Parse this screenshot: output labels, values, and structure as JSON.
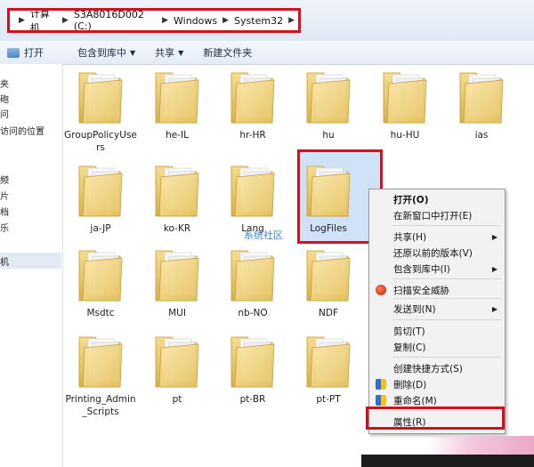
{
  "breadcrumb": {
    "segments": [
      "计算机",
      "S3A8016D002 (C:)",
      "Windows",
      "System32"
    ]
  },
  "toolbar": {
    "open": "打开",
    "include_library": "包含到库中",
    "share": "共享",
    "new_folder": "新建文件夹"
  },
  "nav": {
    "items": [
      "夹",
      "砲",
      "问",
      "访问的位置",
      "频",
      "片",
      "档",
      "乐",
      "机"
    ]
  },
  "folders": [
    "GroupPolicyUsers",
    "he-IL",
    "hr-HR",
    "hu",
    "hu-HU",
    "ias",
    "ja-JP",
    "ko-KR",
    "Lang",
    "LogFiles",
    "Msdtc",
    "MUI",
    "nb-NO",
    "NDF",
    "Printing_Admin_Scripts",
    "pt",
    "pt-BR",
    "pt-PT"
  ],
  "watermark": "系统社区",
  "context_menu": {
    "items": [
      {
        "label": "打开(O)",
        "bold": true
      },
      {
        "label": "在新窗口中打开(E)"
      },
      {
        "label": "共享(H)",
        "submenu": true
      },
      {
        "label": "还原以前的版本(V)"
      },
      {
        "label": "包含到库中(I)",
        "submenu": true
      },
      {
        "label": "扫描安全威胁"
      },
      {
        "label": "发送到(N)",
        "submenu": true
      },
      {
        "label": "剪切(T)"
      },
      {
        "label": "复制(C)"
      },
      {
        "label": "创建快捷方式(S)"
      },
      {
        "label": "删除(D)"
      },
      {
        "label": "重命名(M)"
      },
      {
        "label": "属性(R)"
      }
    ]
  },
  "colors": {
    "highlight_red": "#d2101e",
    "selection_blue": "#cfe2f8"
  }
}
